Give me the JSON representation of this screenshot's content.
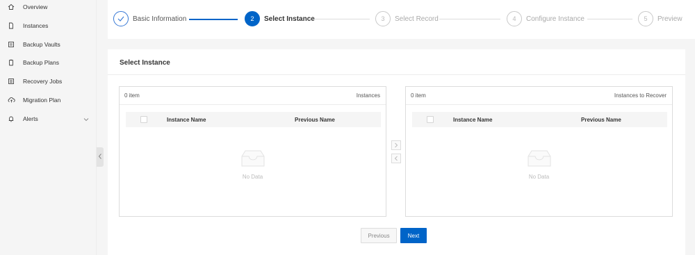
{
  "sidebar": {
    "items": [
      {
        "label": "Overview",
        "icon": "home-icon"
      },
      {
        "label": "Instances",
        "icon": "file-icon"
      },
      {
        "label": "Backup Vaults",
        "icon": "vault-icon"
      },
      {
        "label": "Backup Plans",
        "icon": "clipboard-icon"
      },
      {
        "label": "Recovery Jobs",
        "icon": "list-icon"
      },
      {
        "label": "Migration Plan",
        "icon": "cloud-icon"
      },
      {
        "label": "Alerts",
        "icon": "bell-icon",
        "has_chevron": true
      }
    ]
  },
  "steps": [
    {
      "number": "1",
      "label": "Basic Information",
      "state": "done"
    },
    {
      "number": "2",
      "label": "Select Instance",
      "state": "active"
    },
    {
      "number": "3",
      "label": "Select Record",
      "state": "pending"
    },
    {
      "number": "4",
      "label": "Configure Instance",
      "state": "pending"
    },
    {
      "number": "5",
      "label": "Preview",
      "state": "pending"
    }
  ],
  "card": {
    "title": "Select Instance",
    "left_panel": {
      "count": "0 item",
      "name": "Instances",
      "col1": "Instance Name",
      "col2": "Previous Name",
      "empty": "No Data"
    },
    "right_panel": {
      "count": "0 item",
      "name": "Instances to Recover",
      "col1": "Instance Name",
      "col2": "Previous Name",
      "empty": "No Data"
    },
    "buttons": {
      "previous": "Previous",
      "next": "Next"
    }
  },
  "colors": {
    "primary": "#0064c8",
    "border": "#dcdcdc",
    "background": "#f5f5f5"
  }
}
